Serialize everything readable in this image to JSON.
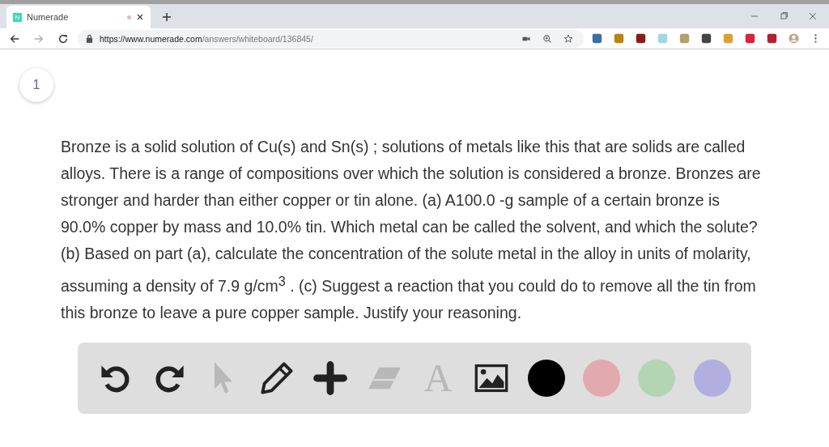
{
  "browser": {
    "tab": {
      "title": "Numerade",
      "favicon": "N"
    },
    "url_host": "https://www.numerade.com",
    "url_path": "/answers/whiteboard/136845/"
  },
  "page": {
    "step_number": "1",
    "question": "Bronze is a solid solution of Cu(s) and Sn(s) ; solutions of metals like this that are solids are called alloys. There is a range of compositions over which the solution is considered a bronze. Bronzes are stronger and harder than either copper or tin alone. (a) A100.0 -g sample of a certain bronze is 90.0% copper by mass and 10.0% tin. Which metal can be called the solvent, and which the solute? (b) Based on part (a), calculate the concentration of the solute metal in the alloy in units of molarity, assuming a density of 7.9 g/cm$^{3}$ . (c) Suggest a reaction that you could do to remove all the tin from this bronze to leave a pure copper sample. Justify your reasoning."
  },
  "toolbar": {
    "tools": [
      {
        "kind": "undo",
        "disabled": false
      },
      {
        "kind": "redo",
        "disabled": false
      },
      {
        "kind": "pointer",
        "disabled": true
      },
      {
        "kind": "pencil",
        "disabled": false
      },
      {
        "kind": "plus",
        "disabled": false
      },
      {
        "kind": "eraser",
        "disabled": true
      },
      {
        "kind": "text",
        "disabled": true,
        "glyph": "A"
      },
      {
        "kind": "image",
        "disabled": false
      }
    ],
    "colors": [
      {
        "color": "#000000"
      },
      {
        "color": "#e2a9ae"
      },
      {
        "color": "#b4d5b4"
      },
      {
        "color": "#b2aee0"
      }
    ]
  }
}
